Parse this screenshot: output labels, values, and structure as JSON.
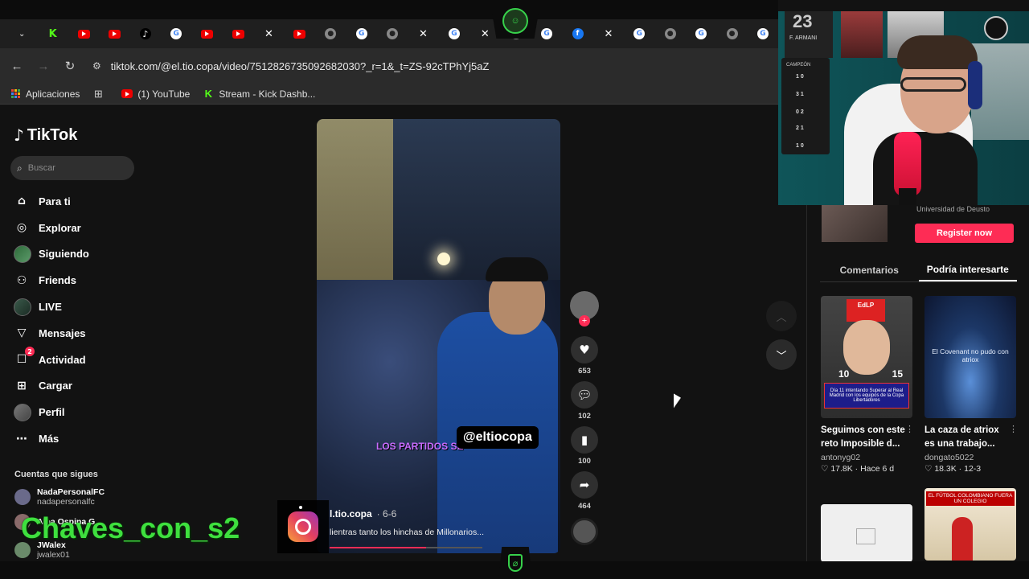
{
  "browser": {
    "url": "tiktok.com/@el.tio.copa/video/7512826735092682030?_r=1&_t=ZS-92cTPhYj5aZ",
    "tab_icons": [
      "chevron-down",
      "kick",
      "youtube",
      "youtube",
      "tiktok",
      "google",
      "youtube",
      "youtube",
      "x",
      "youtube",
      "github",
      "google",
      "github",
      "x",
      "google",
      "x",
      "github",
      "google",
      "facebook",
      "x",
      "google",
      "github",
      "google",
      "github",
      "google"
    ],
    "bookmarks": [
      {
        "label": "Aplicaciones",
        "icon": "apps-grid-icon"
      },
      {
        "label": "",
        "icon": "grid-icon"
      },
      {
        "label": "(1) YouTube",
        "icon": "youtube-icon"
      },
      {
        "label": "Stream - Kick Dashb...",
        "icon": "kick-icon"
      }
    ]
  },
  "tiktok": {
    "logo": "TikTok",
    "search_placeholder": "Buscar",
    "menu": [
      {
        "label": "Para ti",
        "icon": "home-icon"
      },
      {
        "label": "Explorar",
        "icon": "compass-icon"
      },
      {
        "label": "Siguiendo",
        "icon": "following-avatar"
      },
      {
        "label": "Friends",
        "icon": "friends-icon"
      },
      {
        "label": "LIVE",
        "icon": "live-avatar"
      },
      {
        "label": "Mensajes",
        "icon": "messages-icon"
      },
      {
        "label": "Actividad",
        "icon": "activity-icon",
        "badge": "2"
      },
      {
        "label": "Cargar",
        "icon": "upload-icon"
      },
      {
        "label": "Perfil",
        "icon": "profile-avatar"
      },
      {
        "label": "Más",
        "icon": "more-icon"
      }
    ],
    "following_title": "Cuentas que sigues",
    "following": [
      {
        "name": "NadaPersonalFC",
        "handle": "nadapersonalfc"
      },
      {
        "name": "Alba Ospina G",
        "handle": ""
      },
      {
        "name": "JWalex",
        "handle": "jwalex01"
      }
    ]
  },
  "video": {
    "watermark": "@eltiocopa",
    "subtitle": "LOS PARTIDOS SE",
    "author": "l.tio.copa",
    "date": "· 6-6",
    "description": "lientras tanto los hinchas de Millonarios...",
    "progress": 0.63,
    "actions": {
      "likes": "653",
      "comments": "102",
      "saves": "100",
      "shares": "464"
    }
  },
  "right_panel": {
    "ad_text": "Universidad de Deusto",
    "register_label": "Register now",
    "tabs": [
      "Comentarios",
      "Podría interesarte"
    ],
    "active_tab": 1,
    "cards": [
      {
        "title": "Seguimos con este reto Imposible d...",
        "author": "antonyg02",
        "meta": "♡ 17.8K · Hace 6 d",
        "thumb_top": "EdLP",
        "thumb_nums": [
          "10",
          "15"
        ],
        "thumb_caption": "Día 11 intentando Superar al Real Madrid con los equipos de la Copa Libertadores"
      },
      {
        "title": "La caza de atriox es una trabajo...",
        "author": "dongato5022",
        "meta": "♡ 18.3K · 12-3",
        "thumb_caption": "El Covenant no pudo con atriox"
      },
      {
        "title": "",
        "author": "",
        "meta": ""
      },
      {
        "title": "",
        "author": "",
        "meta": "",
        "thumb_caption": "EL FÚTBOL COLOMBIANO FUERA UN COLEGIO"
      }
    ]
  },
  "stream_overlay": {
    "name": "Chaves_con_s2",
    "webcam": {
      "jersey_number": "23",
      "jersey_name": "F. ARMANI",
      "board_title": "CAMPEÓN",
      "scores": [
        "1 0",
        "3 1",
        "0 2",
        "2 1",
        "1 0"
      ]
    }
  },
  "colors": {
    "accent": "#fe2c55",
    "overlay_green": "#3ee03e",
    "page_bg": "#121212"
  }
}
